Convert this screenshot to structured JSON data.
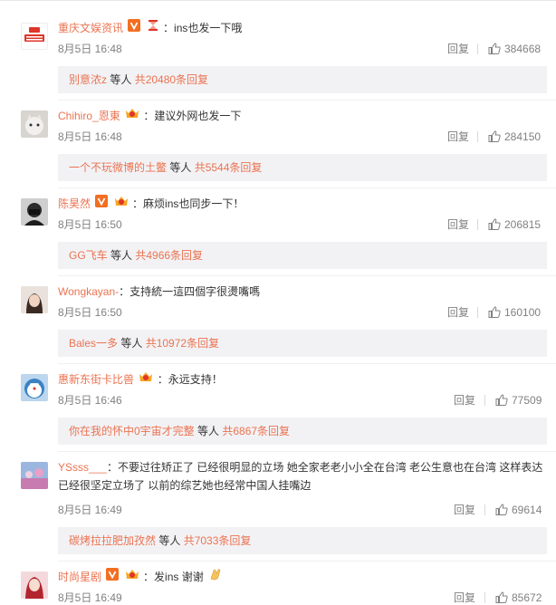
{
  "comments": [
    {
      "user": "重庆文娱资讯",
      "text": "：ins也发一下哦",
      "date": "8月5日 16:48",
      "reply_label": "回复",
      "likes": "384668",
      "sub": {
        "user": "别意浓z",
        "mid": " 等人 ",
        "count": "共20480条回复"
      }
    },
    {
      "user": "Chihiro_恩東",
      "text": "：建议外网也发一下",
      "date": "8月5日 16:48",
      "reply_label": "回复",
      "likes": "284150",
      "sub": {
        "user": "一个不玩微博的土鳖",
        "mid": " 等人 ",
        "count": "共5544条回复"
      }
    },
    {
      "user": "陈昊然",
      "text": "：麻烦ins也同步一下！",
      "date": "8月5日 16:50",
      "reply_label": "回复",
      "likes": "206815",
      "sub": {
        "user": "GG飞车",
        "mid": " 等人 ",
        "count": "共4966条回复"
      }
    },
    {
      "user": "Wongkayan-",
      "text": "：支持統一這四個字很燙嘴嗎",
      "date": "8月5日 16:50",
      "reply_label": "回复",
      "likes": "160100",
      "sub": {
        "user": "Bales一多",
        "mid": " 等人 ",
        "count": "共10972条回复"
      }
    },
    {
      "user": "惠新东街卡比兽",
      "text": "：永远支持！",
      "date": "8月5日 16:46",
      "reply_label": "回复",
      "likes": "77509",
      "sub": {
        "user": "你在我的怀中0宇宙才完整",
        "mid": " 等人 ",
        "count": "共6867条回复"
      }
    },
    {
      "user": "YSsss___",
      "text": "：不要过往矫正了 已经很明显的立场 她全家老老小小全在台湾 老公生意也在台湾 这样表达已经很坚定立场了 以前的综艺她也经常中国人挂嘴边",
      "date": "8月5日 16:49",
      "reply_label": "回复",
      "likes": "69614",
      "sub": {
        "user": "碳烤拉拉肥加孜然",
        "mid": " 等人 ",
        "count": "共7033条回复"
      }
    },
    {
      "user": "时尚星剧",
      "text": "：发ins 谢谢",
      "date": "8月5日 16:49",
      "reply_label": "回复",
      "likes": "85672"
    }
  ],
  "icons": {
    "like": "thumbs-up-icon",
    "vip": "vip-v-icon",
    "fan": "fan-crown-icon",
    "hourglass": "hourglass-icon",
    "clap": "clapping-hands-emoji"
  },
  "colors": {
    "name": "#eb7350",
    "meta": "#808080",
    "subbox_bg": "#f2f2f5",
    "vip": "#f36e21"
  }
}
